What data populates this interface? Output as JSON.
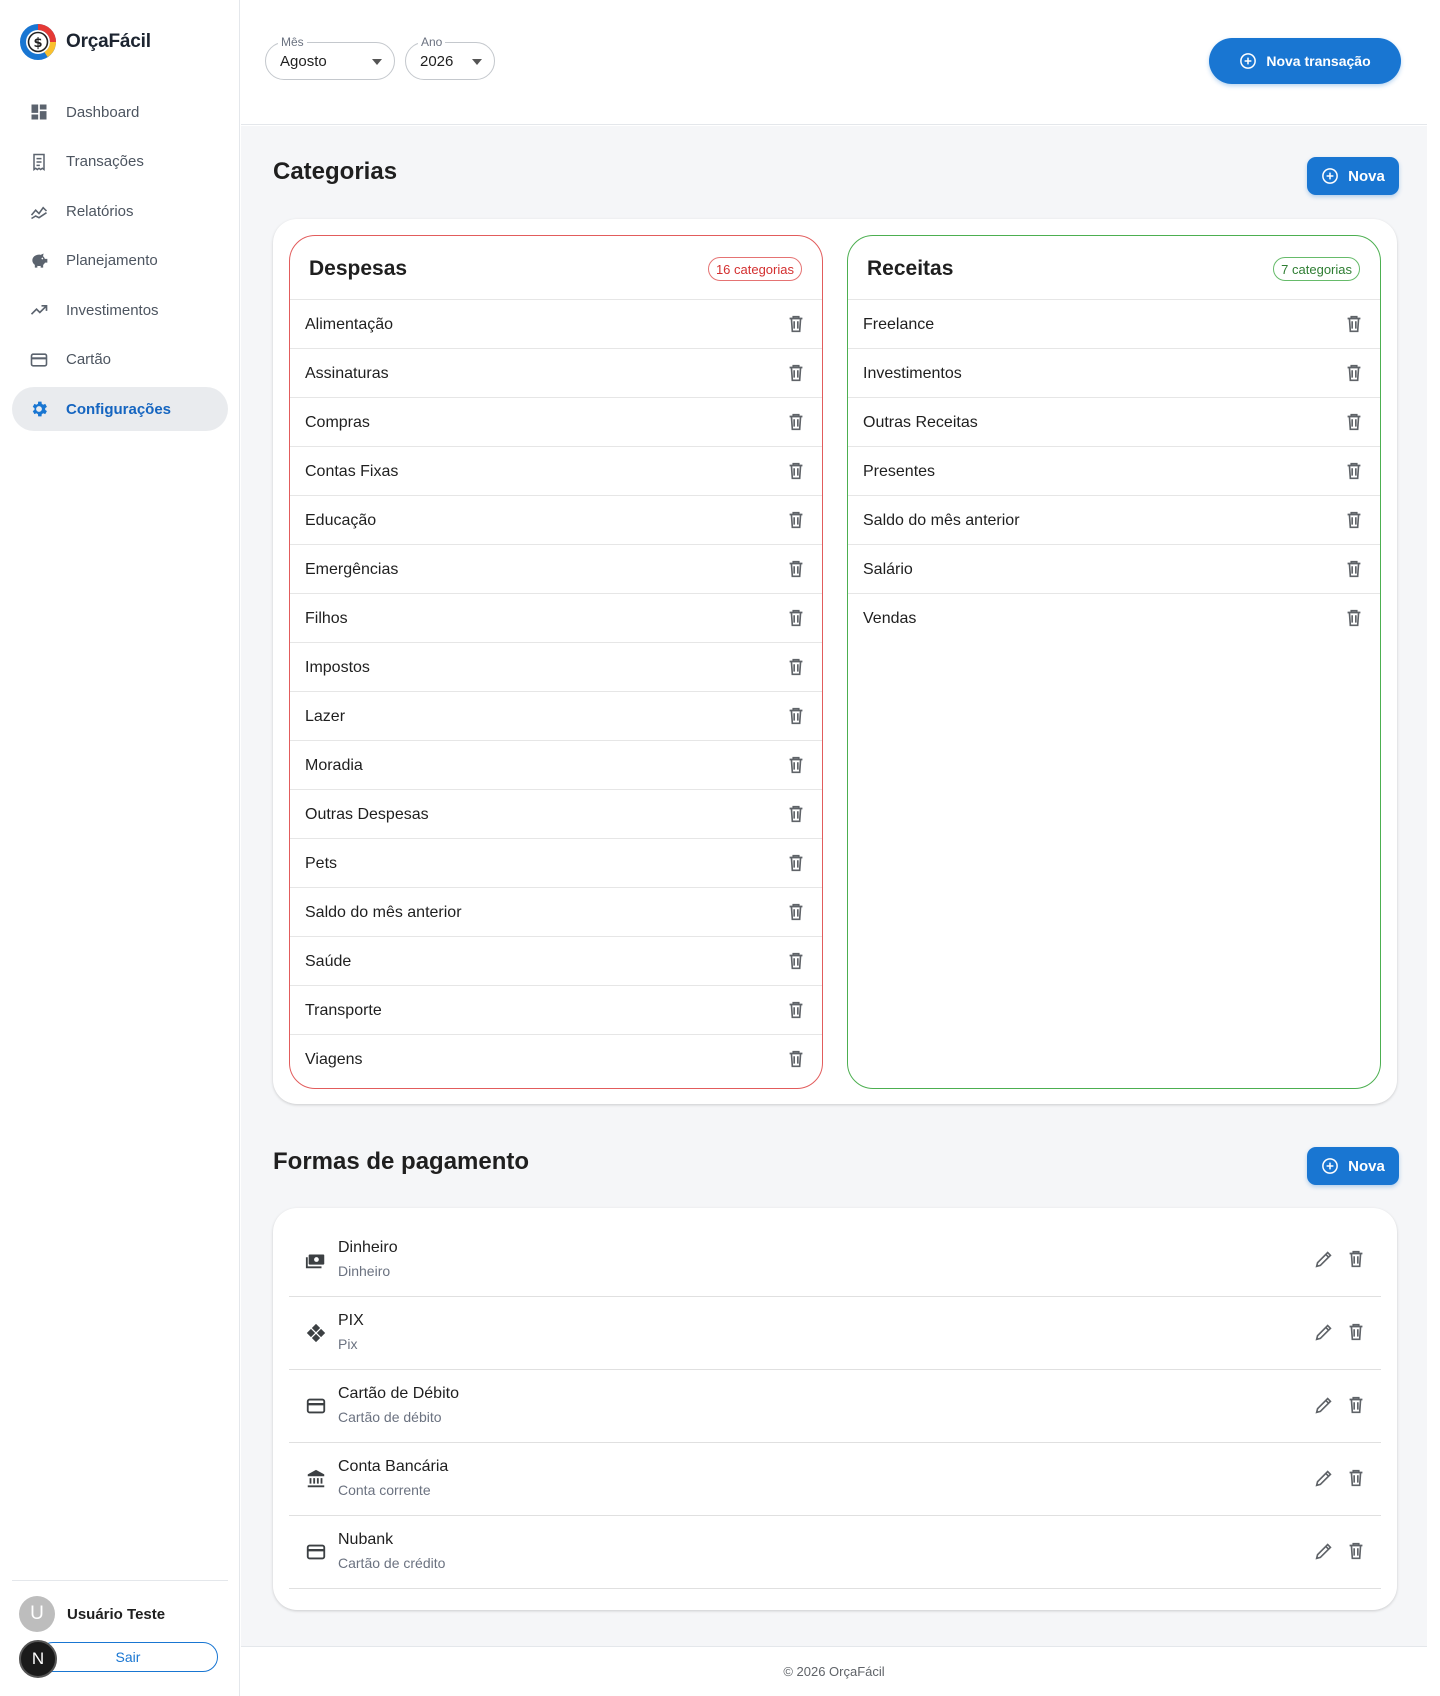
{
  "app": {
    "name": "OrçaFácil"
  },
  "sidebar": {
    "items": [
      {
        "label": "Dashboard",
        "icon": "dashboard-icon",
        "active": false
      },
      {
        "label": "Transações",
        "icon": "receipt-icon",
        "active": false
      },
      {
        "label": "Relatórios",
        "icon": "chart-line-icon",
        "active": false
      },
      {
        "label": "Planejamento",
        "icon": "piggy-bank-icon",
        "active": false
      },
      {
        "label": "Investimentos",
        "icon": "trending-up-icon",
        "active": false
      },
      {
        "label": "Cartão",
        "icon": "credit-card-icon",
        "active": false
      },
      {
        "label": "Configurações",
        "icon": "gear-icon",
        "active": true
      }
    ],
    "user": {
      "initial": "U",
      "name": "Usuário Teste"
    },
    "logout_label": "Sair",
    "badge": "N"
  },
  "topbar": {
    "month": {
      "label": "Mês",
      "value": "Agosto"
    },
    "year": {
      "label": "Ano",
      "value": "2026"
    },
    "new_transaction_label": "Nova transação"
  },
  "categories": {
    "title": "Categorias",
    "new_label": "Nova",
    "expenses": {
      "title": "Despesas",
      "count_label": "16 categorias",
      "items": [
        "Alimentação",
        "Assinaturas",
        "Compras",
        "Contas Fixas",
        "Educação",
        "Emergências",
        "Filhos",
        "Impostos",
        "Lazer",
        "Moradia",
        "Outras Despesas",
        "Pets",
        "Saldo do mês anterior",
        "Saúde",
        "Transporte",
        "Viagens"
      ]
    },
    "income": {
      "title": "Receitas",
      "count_label": "7 categorias",
      "items": [
        "Freelance",
        "Investimentos",
        "Outras Receitas",
        "Presentes",
        "Saldo do mês anterior",
        "Salário",
        "Vendas"
      ]
    }
  },
  "payments": {
    "title": "Formas de pagamento",
    "new_label": "Nova",
    "items": [
      {
        "name": "Dinheiro",
        "type": "Dinheiro",
        "icon": "cash-icon"
      },
      {
        "name": "PIX",
        "type": "Pix",
        "icon": "pix-icon"
      },
      {
        "name": "Cartão de Débito",
        "type": "Cartão de débito",
        "icon": "card-icon"
      },
      {
        "name": "Conta Bancária",
        "type": "Conta corrente",
        "icon": "bank-icon"
      },
      {
        "name": "Nubank",
        "type": "Cartão de crédito",
        "icon": "card-icon"
      }
    ]
  },
  "footer": {
    "text": "© 2026 OrçaFácil"
  },
  "colors": {
    "primary": "#1976d2",
    "expense_border": "#e25c5c",
    "income_border": "#4caf50",
    "active_nav_bg": "#e9ebee"
  }
}
